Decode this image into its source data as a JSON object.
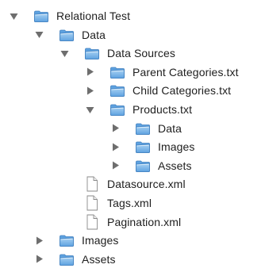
{
  "tree": {
    "rows": [
      {
        "label": "Relational Test",
        "type": "folder",
        "state": "expanded",
        "level": 0,
        "icon": "folder-icon"
      },
      {
        "label": "Data",
        "type": "folder",
        "state": "expanded",
        "level": 1,
        "icon": "folder-icon"
      },
      {
        "label": "Data Sources",
        "type": "folder",
        "state": "expanded",
        "level": 2,
        "icon": "folder-icon"
      },
      {
        "label": "Parent Categories.txt",
        "type": "folder",
        "state": "collapsed",
        "level": 3,
        "icon": "folder-icon"
      },
      {
        "label": "Child Categories.txt",
        "type": "folder",
        "state": "collapsed",
        "level": 3,
        "icon": "folder-icon"
      },
      {
        "label": "Products.txt",
        "type": "folder",
        "state": "expanded",
        "level": 3,
        "icon": "folder-icon"
      },
      {
        "label": "Data",
        "type": "folder",
        "state": "collapsed",
        "level": 4,
        "icon": "folder-icon"
      },
      {
        "label": "Images",
        "type": "folder",
        "state": "collapsed",
        "level": 4,
        "icon": "folder-icon"
      },
      {
        "label": "Assets",
        "type": "folder",
        "state": "collapsed",
        "level": 4,
        "icon": "folder-icon"
      },
      {
        "label": "Datasource.xml",
        "type": "file",
        "state": "none",
        "level": 2,
        "icon": "document-icon"
      },
      {
        "label": "Tags.xml",
        "type": "file",
        "state": "none",
        "level": 2,
        "icon": "document-icon"
      },
      {
        "label": "Pagination.xml",
        "type": "file",
        "state": "none",
        "level": 2,
        "icon": "document-icon"
      },
      {
        "label": "Images",
        "type": "folder",
        "state": "collapsed",
        "level": 1,
        "icon": "folder-icon"
      },
      {
        "label": "Assets",
        "type": "folder",
        "state": "collapsed",
        "level": 1,
        "icon": "folder-icon"
      }
    ]
  },
  "colors": {
    "toggle": "#6e6e6e",
    "folder_top": "#a9d2f3",
    "folder_bottom": "#5ea2e0",
    "folder_edge": "#3f7fbf",
    "document_fill": "#ffffff",
    "document_edge": "#8a8a8a"
  }
}
